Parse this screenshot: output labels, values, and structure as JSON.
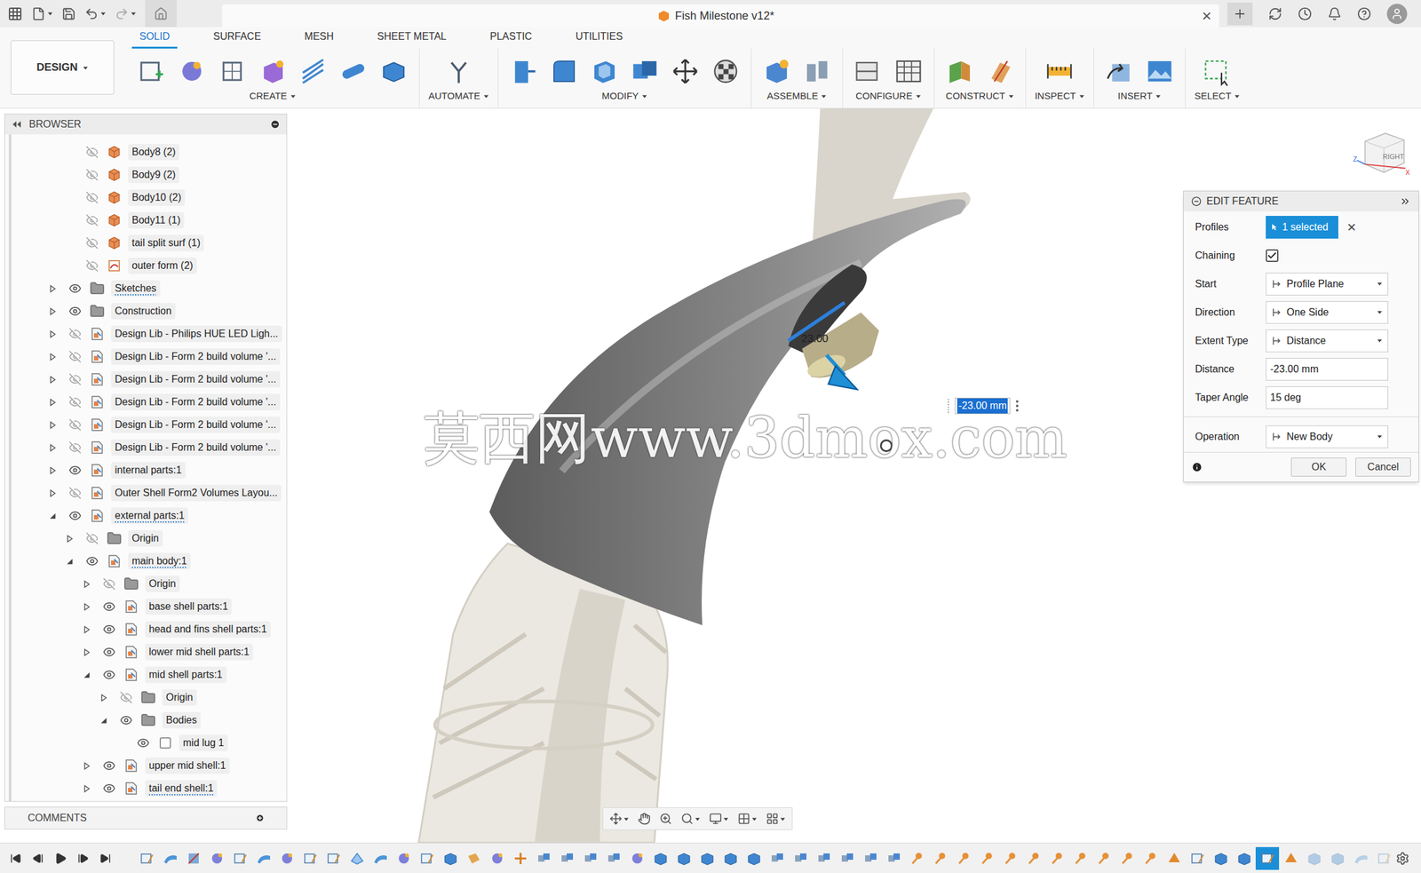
{
  "window": {
    "title": "Fish Milestone v12*",
    "close": "×"
  },
  "workspace": "DESIGN",
  "tabs": [
    {
      "label": "SOLID",
      "selected": true
    },
    {
      "label": "SURFACE",
      "selected": false
    },
    {
      "label": "MESH",
      "selected": false
    },
    {
      "label": "SHEET METAL",
      "selected": false
    },
    {
      "label": "PLASTIC",
      "selected": false
    },
    {
      "label": "UTILITIES",
      "selected": false
    }
  ],
  "tool_groups": [
    {
      "label": "CREATE",
      "icons": [
        "sketch",
        "form",
        "derive",
        "box-form",
        "lines",
        "pipe",
        "box"
      ]
    },
    {
      "label": "AUTOMATE",
      "icons": [
        "automate"
      ]
    },
    {
      "label": "MODIFY",
      "icons": [
        "press-pull",
        "fillet",
        "shell",
        "combine",
        "move",
        "appearance"
      ]
    },
    {
      "label": "ASSEMBLE",
      "icons": [
        "component",
        "joint"
      ]
    },
    {
      "label": "CONFIGURE",
      "icons": [
        "config",
        "table"
      ]
    },
    {
      "label": "CONSTRUCT",
      "icons": [
        "plane",
        "axis"
      ]
    },
    {
      "label": "INSPECT",
      "icons": [
        "measure"
      ]
    },
    {
      "label": "INSERT",
      "icons": [
        "insert",
        "image"
      ]
    },
    {
      "label": "SELECT",
      "icons": [
        "select"
      ]
    }
  ],
  "browser": {
    "title": "BROWSER",
    "items": [
      {
        "label": "Body8 (2)",
        "level": 1,
        "kind": "body",
        "visible": false,
        "has_children": false,
        "expanded": false,
        "linked": false
      },
      {
        "label": "Body9 (2)",
        "level": 1,
        "kind": "body",
        "visible": false,
        "has_children": false,
        "expanded": false,
        "linked": false
      },
      {
        "label": "Body10 (2)",
        "level": 1,
        "kind": "body",
        "visible": false,
        "has_children": false,
        "expanded": false,
        "linked": false
      },
      {
        "label": "Body11 (1)",
        "level": 1,
        "kind": "body",
        "visible": false,
        "has_children": false,
        "expanded": false,
        "linked": false
      },
      {
        "label": "tail split surf (1)",
        "level": 1,
        "kind": "body",
        "visible": false,
        "has_children": false,
        "expanded": false,
        "linked": false
      },
      {
        "label": "outer form (2)",
        "level": 1,
        "kind": "surface",
        "visible": false,
        "has_children": false,
        "expanded": false,
        "linked": false
      },
      {
        "label": "Sketches",
        "level": 0,
        "kind": "folder",
        "visible": true,
        "has_children": true,
        "expanded": false,
        "linked": true
      },
      {
        "label": "Construction",
        "level": 0,
        "kind": "folder",
        "visible": true,
        "has_children": true,
        "expanded": false,
        "linked": false
      },
      {
        "label": "Design Lib - Philips HUE LED Ligh...",
        "level": 0,
        "kind": "component",
        "visible": false,
        "has_children": true,
        "expanded": false,
        "linked": false
      },
      {
        "label": "Design Lib - Form 2 build volume '...",
        "level": 0,
        "kind": "component",
        "visible": false,
        "has_children": true,
        "expanded": false,
        "linked": false
      },
      {
        "label": "Design Lib - Form 2 build volume '...",
        "level": 0,
        "kind": "component",
        "visible": false,
        "has_children": true,
        "expanded": false,
        "linked": false
      },
      {
        "label": "Design Lib - Form 2 build volume '...",
        "level": 0,
        "kind": "component",
        "visible": false,
        "has_children": true,
        "expanded": false,
        "linked": false
      },
      {
        "label": "Design Lib - Form 2 build volume '...",
        "level": 0,
        "kind": "component",
        "visible": false,
        "has_children": true,
        "expanded": false,
        "linked": false
      },
      {
        "label": "Design Lib - Form 2 build volume '...",
        "level": 0,
        "kind": "component",
        "visible": false,
        "has_children": true,
        "expanded": false,
        "linked": false
      },
      {
        "label": "internal parts:1",
        "level": 0,
        "kind": "component",
        "visible": true,
        "has_children": true,
        "expanded": false,
        "linked": false
      },
      {
        "label": "Outer Shell Form2 Volumes Layou...",
        "level": 0,
        "kind": "component",
        "visible": false,
        "has_children": true,
        "expanded": false,
        "linked": false
      },
      {
        "label": "external parts:1",
        "level": 0,
        "kind": "component",
        "visible": true,
        "has_children": true,
        "expanded": true,
        "linked": true
      },
      {
        "label": "Origin",
        "level": 1,
        "kind": "folder",
        "visible": false,
        "has_children": true,
        "expanded": false,
        "linked": false
      },
      {
        "label": "main body:1",
        "level": 1,
        "kind": "component",
        "visible": true,
        "has_children": true,
        "expanded": true,
        "linked": true
      },
      {
        "label": "Origin",
        "level": 2,
        "kind": "folder",
        "visible": false,
        "has_children": true,
        "expanded": false,
        "linked": false
      },
      {
        "label": "base shell parts:1",
        "level": 2,
        "kind": "component",
        "visible": true,
        "has_children": true,
        "expanded": false,
        "linked": false
      },
      {
        "label": "head and fins shell parts:1",
        "level": 2,
        "kind": "component",
        "visible": true,
        "has_children": true,
        "expanded": false,
        "linked": false
      },
      {
        "label": "lower mid shell parts:1",
        "level": 2,
        "kind": "component",
        "visible": true,
        "has_children": true,
        "expanded": false,
        "linked": false
      },
      {
        "label": "mid shell parts:1",
        "level": 2,
        "kind": "component",
        "visible": true,
        "has_children": true,
        "expanded": true,
        "linked": false
      },
      {
        "label": "Origin",
        "level": 3,
        "kind": "folder",
        "visible": false,
        "has_children": true,
        "expanded": false,
        "linked": false
      },
      {
        "label": "Bodies",
        "level": 3,
        "kind": "folder",
        "visible": true,
        "has_children": true,
        "expanded": true,
        "linked": false
      },
      {
        "label": "mid lug 1",
        "level": 4,
        "kind": "body-light",
        "visible": true,
        "has_children": false,
        "expanded": false,
        "linked": false
      },
      {
        "label": "upper mid shell:1",
        "level": 2,
        "kind": "component",
        "visible": true,
        "has_children": true,
        "expanded": false,
        "linked": false
      },
      {
        "label": "tail end shell:1",
        "level": 2,
        "kind": "component",
        "visible": true,
        "has_children": true,
        "expanded": false,
        "linked": true
      }
    ]
  },
  "comments": {
    "title": "COMMENTS"
  },
  "edit_feature": {
    "title": "EDIT FEATURE",
    "rows": [
      {
        "label": "Profiles",
        "kind": "selection",
        "value": "1 selected",
        "clear": "×",
        "section": 1
      },
      {
        "label": "Chaining",
        "kind": "checkbox",
        "checked": true,
        "section": 1
      },
      {
        "label": "Start",
        "kind": "dropdown",
        "value": "Profile Plane",
        "section": 1
      },
      {
        "label": "Direction",
        "kind": "dropdown",
        "value": "One Side",
        "section": 1
      },
      {
        "label": "Extent Type",
        "kind": "dropdown",
        "value": "Distance",
        "section": 1
      },
      {
        "label": "Distance",
        "kind": "input",
        "value": "-23.00 mm",
        "section": 1
      },
      {
        "label": "Taper Angle",
        "kind": "input",
        "value": "15 deg",
        "section": 1
      },
      {
        "label": "Operation",
        "kind": "dropdown",
        "value": "New Body",
        "section": 2
      }
    ],
    "buttons": [
      {
        "label": "OK"
      },
      {
        "label": "Cancel"
      }
    ]
  },
  "viewport": {
    "dimension_label": "23.00",
    "dimension_input": "-23.00 mm",
    "watermark": "莫西网www.3dmox.com",
    "view_cube": {
      "face": "RIGHT",
      "axes": [
        "Z",
        "X"
      ]
    }
  },
  "timeline": {
    "features": [
      {
        "kind": "sketch",
        "selected": false,
        "rolled_back": false
      },
      {
        "kind": "surface",
        "selected": false,
        "rolled_back": false
      },
      {
        "kind": "split",
        "selected": false,
        "rolled_back": false
      },
      {
        "kind": "form",
        "selected": false,
        "rolled_back": false
      },
      {
        "kind": "sketch",
        "selected": false,
        "rolled_back": false
      },
      {
        "kind": "surface",
        "selected": false,
        "rolled_back": false
      },
      {
        "kind": "form",
        "selected": false,
        "rolled_back": false
      },
      {
        "kind": "sketch",
        "selected": false,
        "rolled_back": false
      },
      {
        "kind": "sketch",
        "selected": false,
        "rolled_back": false
      },
      {
        "kind": "patch",
        "selected": false,
        "rolled_back": false
      },
      {
        "kind": "surface",
        "selected": false,
        "rolled_back": false
      },
      {
        "kind": "form",
        "selected": false,
        "rolled_back": false
      },
      {
        "kind": "sketch",
        "selected": false,
        "rolled_back": false
      },
      {
        "kind": "extrude",
        "selected": false,
        "rolled_back": false
      },
      {
        "kind": "plane",
        "selected": false,
        "rolled_back": false
      },
      {
        "kind": "form",
        "selected": false,
        "rolled_back": false
      },
      {
        "kind": "move",
        "selected": false,
        "rolled_back": false
      },
      {
        "kind": "component",
        "selected": false,
        "rolled_back": false
      },
      {
        "kind": "component",
        "selected": false,
        "rolled_back": false
      },
      {
        "kind": "component",
        "selected": false,
        "rolled_back": false
      },
      {
        "kind": "component",
        "selected": false,
        "rolled_back": false
      },
      {
        "kind": "form",
        "selected": false,
        "rolled_back": false
      },
      {
        "kind": "extrude",
        "selected": false,
        "rolled_back": false
      },
      {
        "kind": "extrude",
        "selected": false,
        "rolled_back": false
      },
      {
        "kind": "extrude",
        "selected": false,
        "rolled_back": false
      },
      {
        "kind": "extrude",
        "selected": false,
        "rolled_back": false
      },
      {
        "kind": "extrude",
        "selected": false,
        "rolled_back": false
      },
      {
        "kind": "component",
        "selected": false,
        "rolled_back": false
      },
      {
        "kind": "component",
        "selected": false,
        "rolled_back": false
      },
      {
        "kind": "component",
        "selected": false,
        "rolled_back": false
      },
      {
        "kind": "component",
        "selected": false,
        "rolled_back": false
      },
      {
        "kind": "component",
        "selected": false,
        "rolled_back": false
      },
      {
        "kind": "component",
        "selected": false,
        "rolled_back": false
      },
      {
        "kind": "joint",
        "selected": false,
        "rolled_back": false
      },
      {
        "kind": "joint",
        "selected": false,
        "rolled_back": false
      },
      {
        "kind": "joint",
        "selected": false,
        "rolled_back": false
      },
      {
        "kind": "joint",
        "selected": false,
        "rolled_back": false
      },
      {
        "kind": "joint",
        "selected": false,
        "rolled_back": false
      },
      {
        "kind": "joint",
        "selected": false,
        "rolled_back": false
      },
      {
        "kind": "joint",
        "selected": false,
        "rolled_back": false
      },
      {
        "kind": "joint",
        "selected": false,
        "rolled_back": false
      },
      {
        "kind": "joint",
        "selected": false,
        "rolled_back": false
      },
      {
        "kind": "joint",
        "selected": false,
        "rolled_back": false
      },
      {
        "kind": "joint",
        "selected": false,
        "rolled_back": false
      },
      {
        "kind": "boundary",
        "selected": false,
        "rolled_back": false
      },
      {
        "kind": "sketch",
        "selected": false,
        "rolled_back": false
      },
      {
        "kind": "extrude",
        "selected": false,
        "rolled_back": false
      },
      {
        "kind": "extrude",
        "selected": false,
        "rolled_back": false
      },
      {
        "kind": "sketch",
        "selected": true,
        "rolled_back": false
      },
      {
        "kind": "boundary",
        "selected": false,
        "rolled_back": false
      },
      {
        "kind": "extrude",
        "selected": false,
        "rolled_back": true
      },
      {
        "kind": "extrude",
        "selected": false,
        "rolled_back": true
      },
      {
        "kind": "surface",
        "selected": false,
        "rolled_back": true
      },
      {
        "kind": "sketch",
        "selected": false,
        "rolled_back": true
      }
    ]
  }
}
